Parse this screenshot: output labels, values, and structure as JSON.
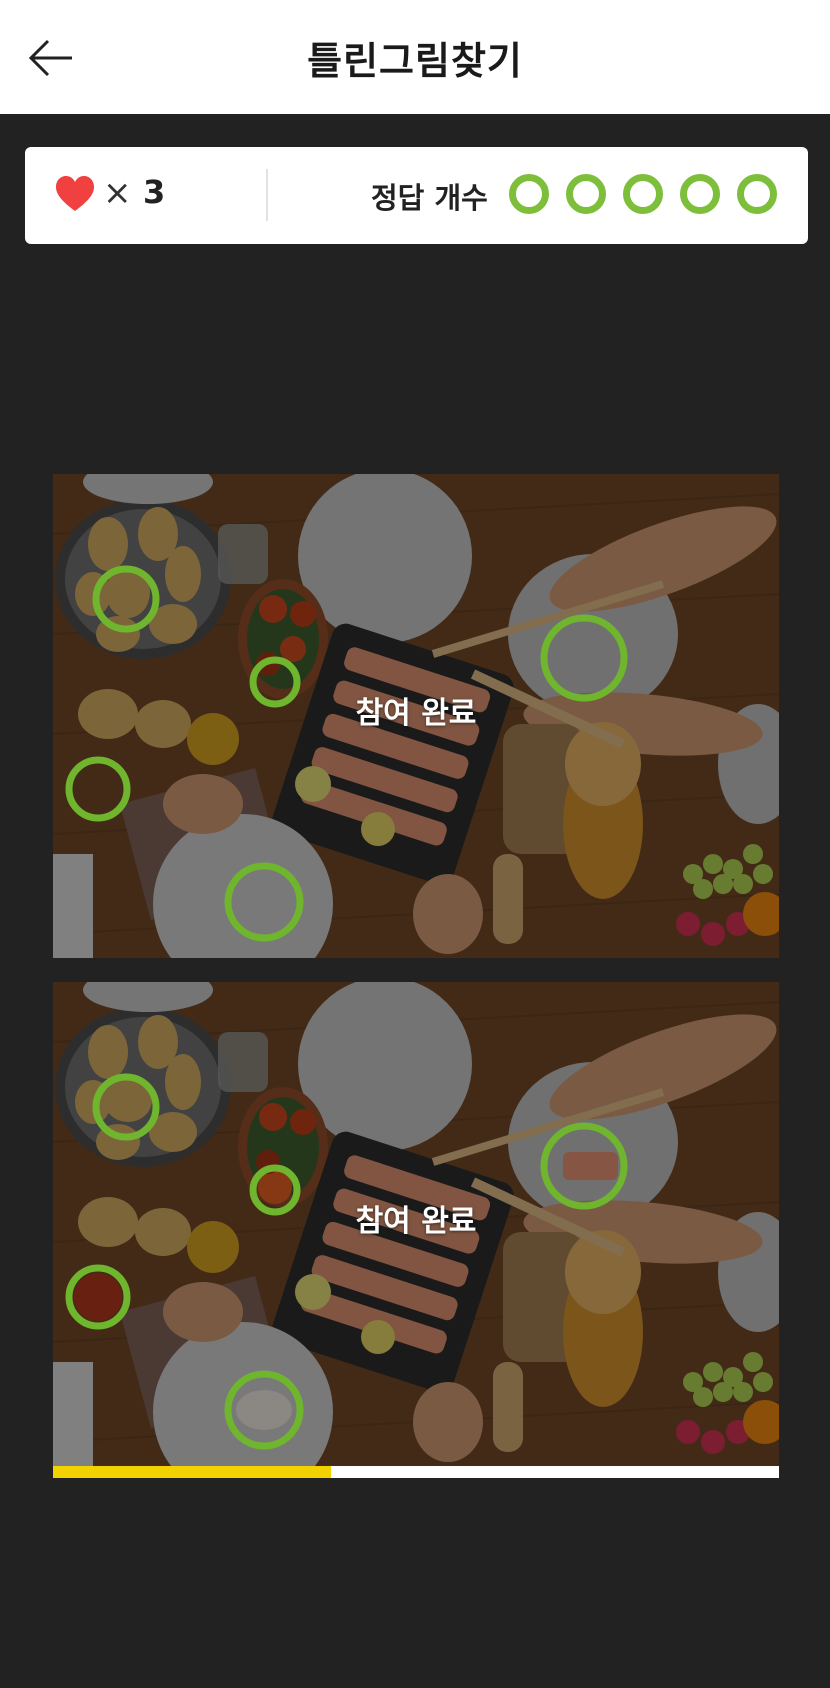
{
  "header": {
    "title": "틀린그림찾기",
    "back_icon": "arrow-left-icon"
  },
  "status": {
    "lives_icon": "heart-icon",
    "times_symbol": "×",
    "lives": "3",
    "answer_label": "정답 개수",
    "answers_found": 5,
    "answers_total": 5,
    "accent_color": "#7dbe3b"
  },
  "game": {
    "panels": [
      {
        "overlay_text": "참여 완료"
      },
      {
        "overlay_text": "참여 완료"
      }
    ],
    "time_progress": 0.383,
    "timer_color": "#f2d300"
  }
}
